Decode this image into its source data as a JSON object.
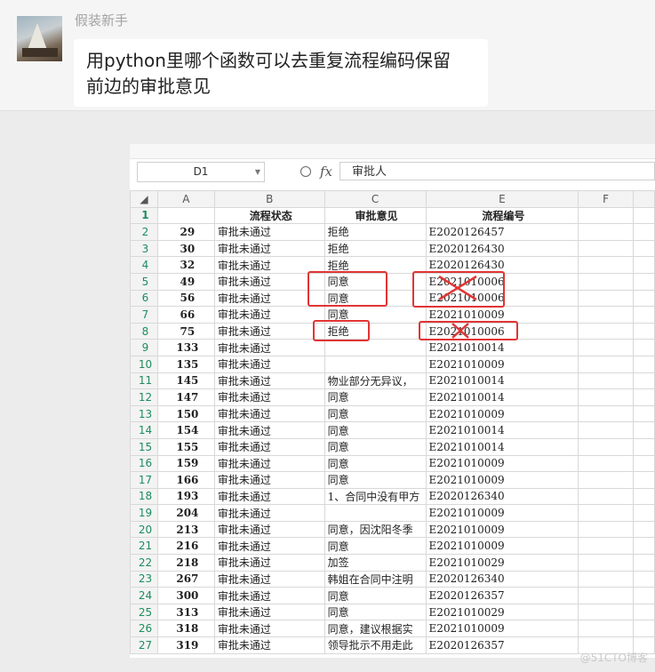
{
  "chat": {
    "sender": "假装新手",
    "message_line1": "用python里哪个函数可以去重复流程编码保留",
    "message_line2": "前边的审批意见"
  },
  "sheet": {
    "name_box": "D1",
    "formula_value": "审批人",
    "columns": [
      "A",
      "B",
      "C",
      "E",
      "F"
    ],
    "header_row": {
      "num": "1",
      "a": "",
      "b": "流程状态",
      "c": "审批意见",
      "e": "流程编号",
      "f": ""
    },
    "rows": [
      {
        "num": "2",
        "a": "29",
        "b": "审批未通过",
        "c": "拒绝",
        "e": "E2020126457"
      },
      {
        "num": "3",
        "a": "30",
        "b": "审批未通过",
        "c": "拒绝",
        "e": "E2020126430"
      },
      {
        "num": "4",
        "a": "32",
        "b": "审批未通过",
        "c": "拒绝",
        "e": "E2020126430"
      },
      {
        "num": "5",
        "a": "49",
        "b": "审批未通过",
        "c": "同意",
        "e": "E2021010006"
      },
      {
        "num": "6",
        "a": "56",
        "b": "审批未通过",
        "c": "同意",
        "e": "E2021010006"
      },
      {
        "num": "7",
        "a": "66",
        "b": "审批未通过",
        "c": "同意",
        "e": "E2021010009"
      },
      {
        "num": "8",
        "a": "75",
        "b": "审批未通过",
        "c": "拒绝",
        "e": "E2021010006"
      },
      {
        "num": "9",
        "a": "133",
        "b": "审批未通过",
        "c": "",
        "e": "E2021010014"
      },
      {
        "num": "10",
        "a": "135",
        "b": "审批未通过",
        "c": "",
        "e": "E2021010009"
      },
      {
        "num": "11",
        "a": "145",
        "b": "审批未通过",
        "c": "物业部分无异议，",
        "e": "E2021010014"
      },
      {
        "num": "12",
        "a": "147",
        "b": "审批未通过",
        "c": "同意",
        "e": "E2021010014"
      },
      {
        "num": "13",
        "a": "150",
        "b": "审批未通过",
        "c": "同意",
        "e": "E2021010009"
      },
      {
        "num": "14",
        "a": "154",
        "b": "审批未通过",
        "c": "同意",
        "e": "E2021010014"
      },
      {
        "num": "15",
        "a": "155",
        "b": "审批未通过",
        "c": "同意",
        "e": "E2021010014"
      },
      {
        "num": "16",
        "a": "159",
        "b": "审批未通过",
        "c": "同意",
        "e": "E2021010009"
      },
      {
        "num": "17",
        "a": "166",
        "b": "审批未通过",
        "c": "同意",
        "e": "E2021010009"
      },
      {
        "num": "18",
        "a": "193",
        "b": "审批未通过",
        "c": "1、合同中没有甲方",
        "e": "E2020126340"
      },
      {
        "num": "19",
        "a": "204",
        "b": "审批未通过",
        "c": "",
        "e": "E2021010009"
      },
      {
        "num": "20",
        "a": "213",
        "b": "审批未通过",
        "c": "同意，因沈阳冬季",
        "e": "E2021010009"
      },
      {
        "num": "21",
        "a": "216",
        "b": "审批未通过",
        "c": "同意",
        "e": "E2021010009"
      },
      {
        "num": "22",
        "a": "218",
        "b": "审批未通过",
        "c": "加签",
        "e": "E2021010029"
      },
      {
        "num": "23",
        "a": "267",
        "b": "审批未通过",
        "c": "韩姐在合同中注明",
        "e": "E2020126340"
      },
      {
        "num": "24",
        "a": "300",
        "b": "审批未通过",
        "c": "同意",
        "e": "E2020126357"
      },
      {
        "num": "25",
        "a": "313",
        "b": "审批未通过",
        "c": "同意",
        "e": "E2021010029"
      },
      {
        "num": "26",
        "a": "318",
        "b": "审批未通过",
        "c": "同意，建议根据实",
        "e": "E2021010009"
      },
      {
        "num": "27",
        "a": "319",
        "b": "审批未通过",
        "c": "领导批示不用走此",
        "e": "E2020126357"
      }
    ]
  },
  "watermark": "@51CTO博客",
  "colors": {
    "annotation": "#e23434",
    "row_number": "#1c8d5e",
    "selection": "#2d9d6b"
  }
}
